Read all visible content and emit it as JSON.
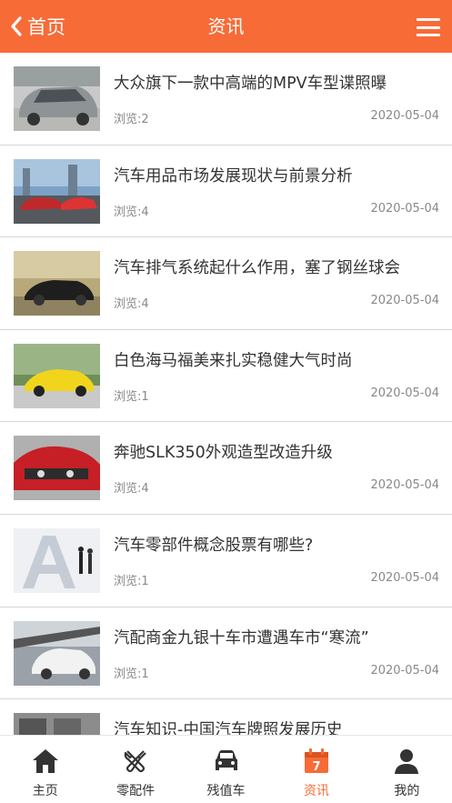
{
  "header": {
    "back_label": "首页",
    "title": "资讯",
    "accent": "#f76b37"
  },
  "articles": [
    {
      "title": "大众旗下一款中高端的MPV车型谍照曝",
      "views": "浏览:2",
      "date": "2020-05-04"
    },
    {
      "title": "汽车用品市场发展现状与前景分析",
      "views": "浏览:4",
      "date": "2020-05-04"
    },
    {
      "title": "汽车排气系统起什么作用，塞了钢丝球会",
      "views": "浏览:4",
      "date": "2020-05-04"
    },
    {
      "title": "白色海马福美来扎实稳健大气时尚",
      "views": "浏览:1",
      "date": "2020-05-04"
    },
    {
      "title": "奔驰SLK350外观造型改造升级",
      "views": "浏览:4",
      "date": "2020-05-04"
    },
    {
      "title": "汽车零部件概念股票有哪些?",
      "views": "浏览:1",
      "date": "2020-05-04"
    },
    {
      "title": "汽配商金九银十车市遭遇车市“寒流”",
      "views": "浏览:1",
      "date": "2020-05-04"
    },
    {
      "title": "汽车知识-中国汽车牌照发展历史",
      "views": "",
      "date": ""
    }
  ],
  "tabs": [
    {
      "label": "主页",
      "icon": "home-icon"
    },
    {
      "label": "零配件",
      "icon": "tools-icon"
    },
    {
      "label": "残值车",
      "icon": "car-icon"
    },
    {
      "label": "资讯",
      "icon": "calendar-icon",
      "badge": "7",
      "active": true
    },
    {
      "label": "我的",
      "icon": "user-icon"
    }
  ]
}
